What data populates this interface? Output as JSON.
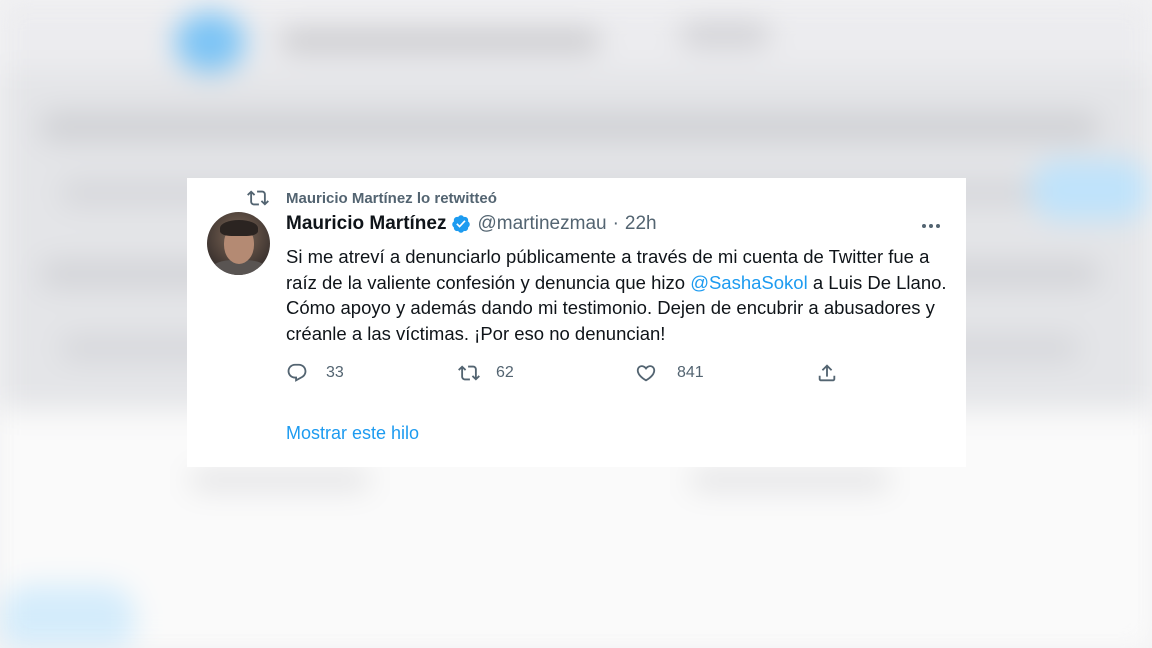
{
  "retweet_context": {
    "label": "Mauricio Martínez lo retwitteó",
    "icon": "retweet-icon"
  },
  "tweet": {
    "author_name": "Mauricio Martínez",
    "verified": true,
    "handle": "@martinezmau",
    "separator": "·",
    "time": "22h",
    "text_before_mention": "Si me atreví a denunciarlo públicamente a través de mi cuenta de Twitter fue a raíz de la valiente confesión y denuncia que hizo ",
    "mention": "@SashaSokol",
    "text_after_mention": " a Luis De Llano. Cómo apoyo y además dando mi testimonio. Dejen de encubrir a abusadores y créanle a las víctimas. ¡Por eso no denuncian!",
    "actions": {
      "replies": "33",
      "retweets": "62",
      "likes": "841"
    },
    "show_thread": "Mostrar este hilo"
  },
  "colors": {
    "accent": "#1d9bf0",
    "secondary_text": "#536471",
    "primary_text": "#0f1419"
  }
}
